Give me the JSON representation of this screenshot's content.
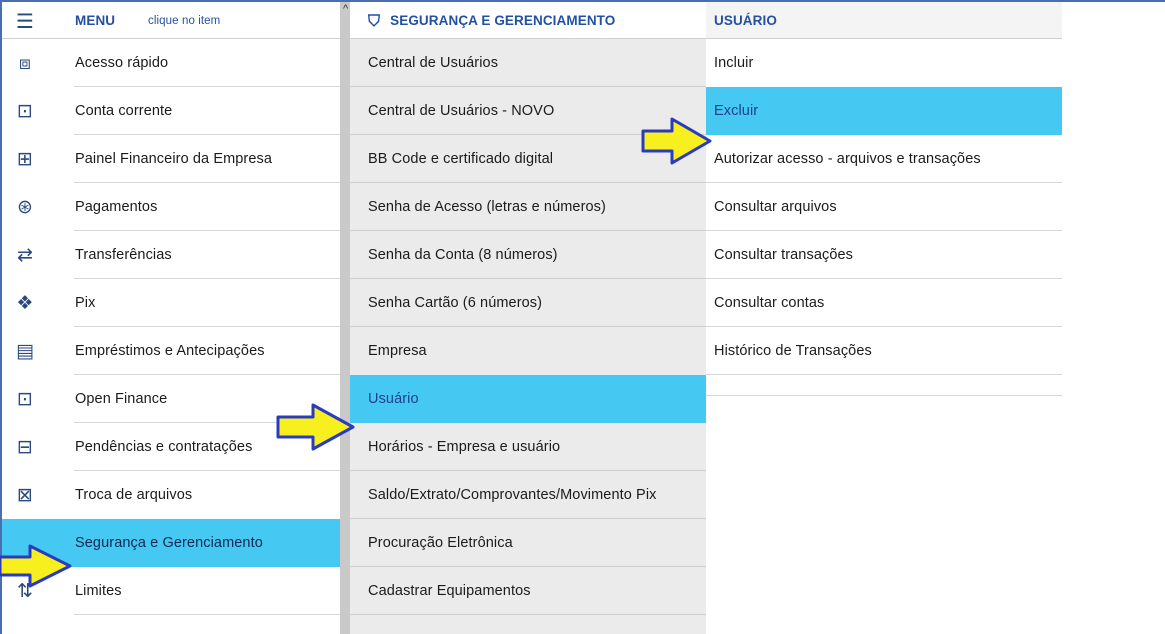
{
  "menu": {
    "title": "MENU",
    "hint": "clique no item",
    "items": [
      {
        "label": "Acesso rápido",
        "icon": "quick-access-icon",
        "glyph": "⧈"
      },
      {
        "label": "Conta corrente",
        "icon": "wallet-icon",
        "glyph": "⊡"
      },
      {
        "label": "Painel Financeiro da Empresa",
        "icon": "monitor-chart-icon",
        "glyph": "⊞"
      },
      {
        "label": "Pagamentos",
        "icon": "payments-icon",
        "glyph": "⊛"
      },
      {
        "label": "Transferências",
        "icon": "transfer-icon",
        "glyph": "⇄"
      },
      {
        "label": "Pix",
        "icon": "pix-icon",
        "glyph": "❖"
      },
      {
        "label": "Empréstimos e Antecipações",
        "icon": "loan-icon",
        "glyph": "▤"
      },
      {
        "label": "Open Finance",
        "icon": "wallet-icon",
        "glyph": "⊡"
      },
      {
        "label": "Pendências e contratações",
        "icon": "document-check-icon",
        "glyph": "⊟"
      },
      {
        "label": "Troca de arquivos",
        "icon": "file-exchange-icon",
        "glyph": "⊠"
      },
      {
        "label": "Segurança e Gerenciamento",
        "icon": "arrow-callout-icon",
        "glyph": ""
      },
      {
        "label": "Limites",
        "icon": "limits-icon",
        "glyph": "⇅"
      }
    ]
  },
  "security": {
    "title": "SEGURANÇA E GERENCIAMENTO",
    "items": [
      "Central de Usuários",
      "Central de Usuários - NOVO",
      "BB Code e certificado digital",
      "Senha de Acesso (letras e números)",
      "Senha da Conta (8 números)",
      "Senha Cartão (6 números)",
      "Empresa",
      "Usuário",
      "Horários - Empresa e usuário",
      "Saldo/Extrato/Comprovantes/Movimento Pix",
      "Procuração Eletrônica",
      "Cadastrar Equipamentos"
    ]
  },
  "user": {
    "title": "USUÁRIO",
    "items": [
      "Incluir",
      "Excluir",
      "Autorizar acesso - arquivos e transações",
      "Consultar arquivos",
      "Consultar transações",
      "Consultar contas",
      "Histórico de Transações"
    ]
  },
  "colors": {
    "highlight": "#45c8f2",
    "accent_text": "#2450a3",
    "arrow_fill": "#f7f01e",
    "arrow_stroke": "#2b3bbf"
  }
}
